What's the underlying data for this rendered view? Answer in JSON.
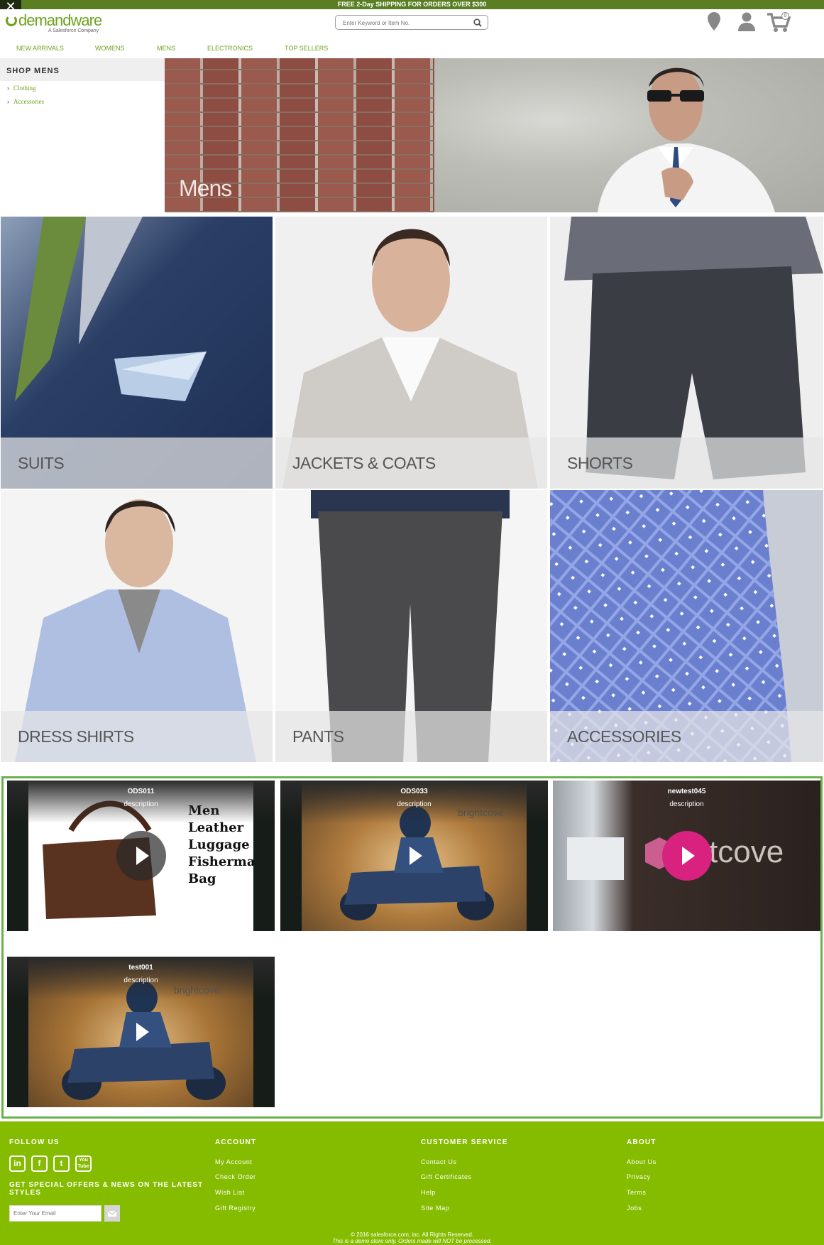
{
  "promo": {
    "text": "FREE 2-Day SHIPPING FOR ORDERS OVER $300"
  },
  "header": {
    "brand": "demandware",
    "tagline": "A Salesforce Company",
    "search_placeholder": "Enter Keyword or Item No.",
    "cart_count": "0"
  },
  "nav": {
    "items": [
      "NEW ARRIVALS",
      "WOMENS",
      "MENS",
      "ELECTRONICS",
      "TOP SELLERS"
    ]
  },
  "sidebar": {
    "heading": "SHOP MENS",
    "links": [
      "Clothing",
      "Accessories"
    ]
  },
  "hero": {
    "label": "Mens"
  },
  "tiles": [
    "SUITS",
    "JACKETS & COATS",
    "SHORTS",
    "DRESS SHIRTS",
    "PANTS",
    "ACCESSORIES"
  ],
  "videos": [
    {
      "title": "ODS011",
      "description": "description",
      "overlay_text": "Men Leather Luggage Fisherman Bag"
    },
    {
      "title": "ODS033",
      "description": "description",
      "overlay_text": "brightcove"
    },
    {
      "title": "newtest045",
      "description": "description",
      "overlay_text": "tcove"
    },
    {
      "title": "test001",
      "description": "description",
      "overlay_text": "brightcove"
    }
  ],
  "footer": {
    "follow_heading": "FOLLOW US",
    "social": [
      "linkedin-icon",
      "facebook-icon",
      "twitter-icon",
      "youtube-icon"
    ],
    "offers_text": "GET SPECIAL OFFERS & NEWS ON THE LATEST STYLES",
    "email_placeholder": "Enter Your Email",
    "account": {
      "heading": "ACCOUNT",
      "links": [
        "My Account",
        "Check Order",
        "Wish List",
        "Gift Registry"
      ]
    },
    "customer_service": {
      "heading": "CUSTOMER SERVICE",
      "links": [
        "Contact Us",
        "Gift Certificates",
        "Help",
        "Site Map"
      ]
    },
    "about": {
      "heading": "ABOUT",
      "links": [
        "About Us",
        "Privacy",
        "Terms",
        "Jobs"
      ]
    },
    "copyright": "© 2016 salesforce.com, inc. All Rights Reserved.",
    "disclaimer": "This is a demo store only. Orders made will NOT be processed."
  },
  "colors": {
    "brand_green": "#6ea21c",
    "promo_green": "#5a7f23",
    "footer_green": "#86bc00",
    "video_border": "#6ab04c",
    "play_pink": "#d9217f"
  }
}
